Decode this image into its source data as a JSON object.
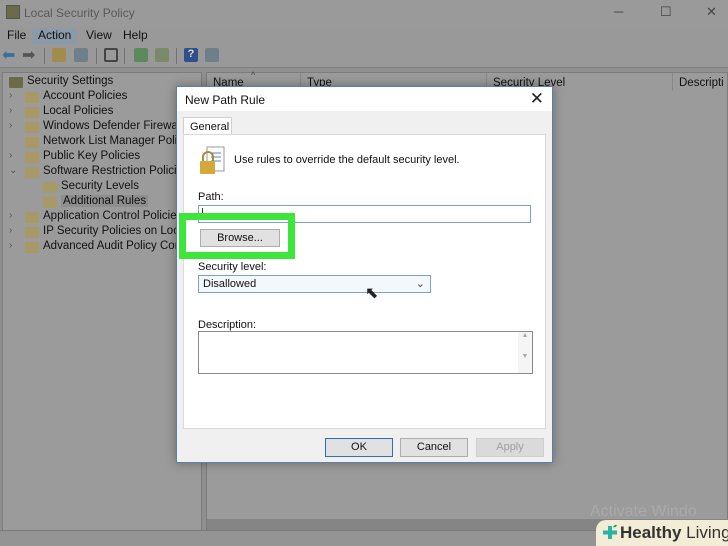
{
  "window": {
    "title": "Local Security Policy",
    "controls": {
      "minimize": "─",
      "maximize": "☐",
      "close": "✕"
    }
  },
  "menu": [
    "File",
    "Action",
    "View",
    "Help"
  ],
  "tree": [
    {
      "label": "Security Settings",
      "level": 0
    },
    {
      "label": "Account Policies",
      "level": 1,
      "expandable": true
    },
    {
      "label": "Local Policies",
      "level": 1,
      "expandable": true
    },
    {
      "label": "Windows Defender Firewall",
      "level": 1,
      "expandable": true
    },
    {
      "label": "Network List Manager Polic",
      "level": 1,
      "expandable": false
    },
    {
      "label": "Public Key Policies",
      "level": 1,
      "expandable": true
    },
    {
      "label": "Software Restriction Policie",
      "level": 1,
      "expanded": true
    },
    {
      "label": "Security Levels",
      "level": 2
    },
    {
      "label": "Additional Rules",
      "level": 2,
      "selected": true
    },
    {
      "label": "Application Control Policie",
      "level": 1,
      "expandable": true
    },
    {
      "label": "IP Security Policies on Loca",
      "level": 1,
      "expandable": true
    },
    {
      "label": "Advanced Audit Policy Cor",
      "level": 1,
      "expandable": true
    }
  ],
  "columns": [
    "Name",
    "Type",
    "Security Level",
    "Descripti"
  ],
  "dialog": {
    "title": "New Path Rule",
    "tab": "General",
    "intro": "Use rules to override the default security level.",
    "path_label": "Path:",
    "path_value": "|",
    "browse": "Browse...",
    "security_label": "Security level:",
    "security_value": "Disallowed",
    "description_label": "Description:",
    "description_value": "",
    "ok": "OK",
    "cancel": "Cancel",
    "apply": "Apply"
  },
  "highlight_color": "#3ee53b",
  "watermark": "Activate Windo",
  "logo": {
    "text_bold": "Healthy",
    "text": " Living"
  }
}
